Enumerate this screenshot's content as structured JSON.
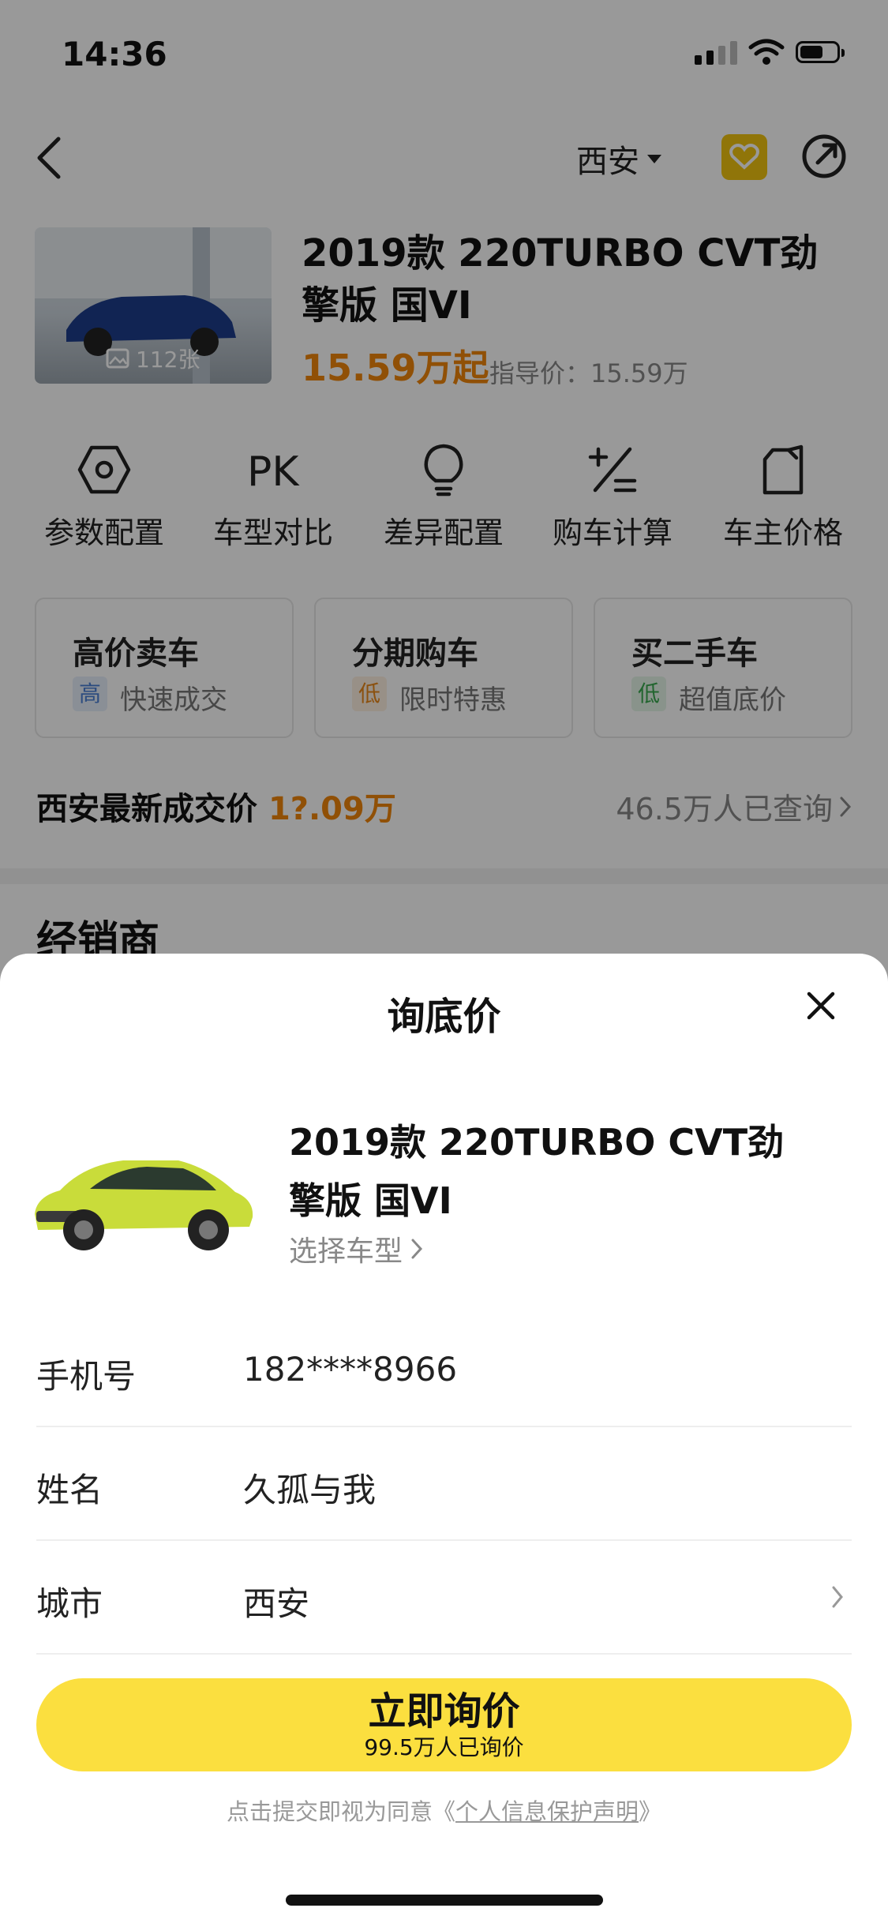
{
  "status_bar": {
    "time": "14:36"
  },
  "nav": {
    "city": "西安"
  },
  "car": {
    "title": "2019款 220TURBO CVT劲擎版 国VI",
    "photo_count": "112张",
    "price": "15.59万起",
    "guide_price": "指导价：15.59万"
  },
  "features": [
    {
      "label": "参数配置",
      "icon": "hexagon-settings-icon"
    },
    {
      "label": "车型对比",
      "icon": "pk-icon"
    },
    {
      "label": "差异配置",
      "icon": "bulb-icon"
    },
    {
      "label": "购车计算",
      "icon": "calculator-icon"
    },
    {
      "label": "车主价格",
      "icon": "tag-icon"
    }
  ],
  "services": [
    {
      "title": "高价卖车",
      "tag": "高",
      "subtitle": "快速成交",
      "tag_color": "#4a7fd4"
    },
    {
      "title": "分期购车",
      "tag": "低",
      "subtitle": "限时特惠",
      "tag_color": "#e8871a"
    },
    {
      "title": "买二手车",
      "tag": "低",
      "subtitle": "超值底价",
      "tag_color": "#3aa84f"
    }
  ],
  "recent": {
    "label": "西安最新成交价",
    "value": "1?.09万",
    "queried": "46.5万人已查询"
  },
  "dealer_heading": "经销商",
  "sheet": {
    "title": "询底价",
    "model": "2019款 220TURBO CVT劲擎版 国VI",
    "choose_model": "选择车型",
    "fields": [
      {
        "label": "手机号",
        "value": "182****8966"
      },
      {
        "label": "姓名",
        "value": "久孤与我"
      },
      {
        "label": "城市",
        "value": "西安"
      }
    ],
    "cta_main": "立即询价",
    "cta_sub": "99.5万人已询价",
    "agreement_prefix": "点击提交即视为同意《",
    "agreement_link": "个人信息保护声明",
    "agreement_suffix": "》"
  },
  "colors": {
    "accent_yellow": "#fbdf3f",
    "price_orange": "#f0850a"
  }
}
